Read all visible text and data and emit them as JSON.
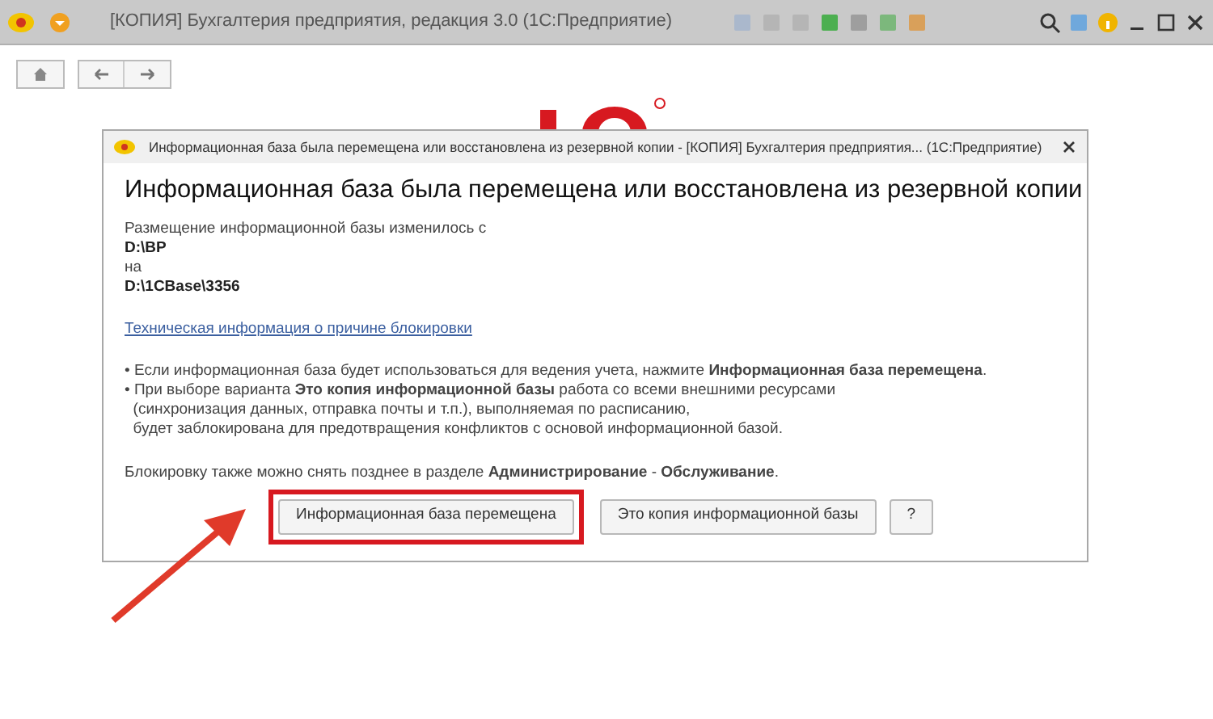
{
  "window": {
    "title": "[КОПИЯ] Бухгалтерия предприятия, редакция 3.0  (1С:Предприятие)"
  },
  "dialog": {
    "title": "Информационная база была перемещена или восстановлена из резервной копии - [КОПИЯ] Бухгалтерия предприятия... (1С:Предприятие)",
    "heading": "Информационная база была перемещена или восстановлена из резервной копии",
    "location_lines": [
      {
        "text": "Размещение информационной базы изменилось с",
        "bold": false
      },
      {
        "text": "D:\\BP",
        "bold": true
      },
      {
        "text": "на",
        "bold": false
      },
      {
        "text": "D:\\1CBase\\3356",
        "bold": true
      }
    ],
    "link": "Техническая информация о причине блокировки",
    "bullets": [
      {
        "lines": [
          "• Если информационная база будет использоваться для ведения учета, нажмите **Информационная база перемещена**."
        ]
      },
      {
        "lines": [
          "• При выборе варианта **Это копия информационной базы** работа со всеми внешними ресурсами",
          "  (синхронизация данных, отправка почты и т.п.), выполняемая по расписанию,",
          "  будет заблокирована для предотвращения конфликтов с основой информационной базой."
        ]
      }
    ],
    "note": "Блокировку также можно снять позднее в разделе **Администрирование** - **Обслуживание**.",
    "buttons": [
      {
        "label": "Информационная база перемещена",
        "highlighted": true
      },
      {
        "label": "Это копия информационной базы",
        "highlighted": false
      },
      {
        "label": "?",
        "highlighted": false
      }
    ]
  }
}
